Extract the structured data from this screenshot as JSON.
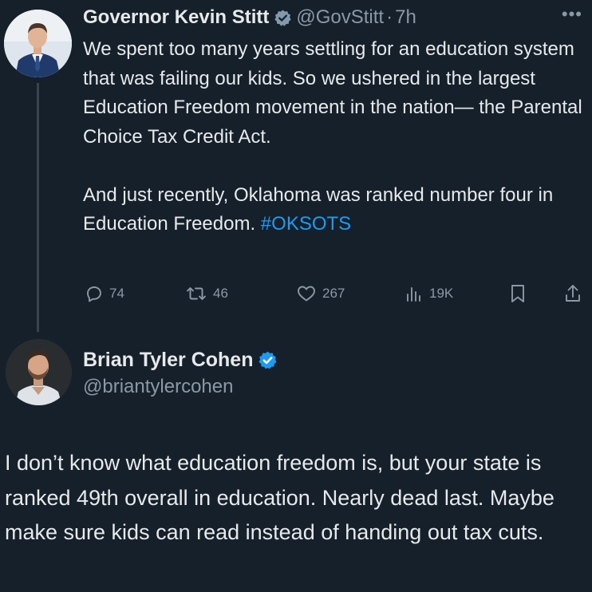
{
  "tweet1": {
    "author_name": "Governor Kevin Stitt",
    "handle": "@GovStitt",
    "separator": "·",
    "time": "7h",
    "more_label": "•••",
    "text_paragraph_1": "We spent too many years settling for an education system that was failing our kids. So we ushered in the largest Education Freedom movement in the nation— the Parental Choice Tax Credit Act.",
    "text_paragraph_2": "And just recently, Oklahoma was ranked number four in Education Freedom.",
    "hashtag": "#OKSOTS",
    "actions": {
      "replies": "74",
      "reposts": "46",
      "likes": "267",
      "views": "19K"
    },
    "badge_color": "#829aab"
  },
  "tweet2": {
    "author_name": "Brian Tyler Cohen",
    "handle": "@briantylercohen",
    "text": "I don’t know what education freedom is, but your state is ranked 49th overall in education. Nearly dead last. Maybe make sure kids can read instead of handing out tax cuts.",
    "badge_color": "#1d9bf0"
  },
  "theme": {
    "background": "#15202b",
    "text": "#e7e9ea",
    "muted": "#8b98a5",
    "accent": "#1d9bf0"
  },
  "icons": {
    "reply": "reply-icon",
    "repost": "repost-icon",
    "like": "like-icon",
    "views": "views-icon",
    "bookmark": "bookmark-icon",
    "share": "share-icon",
    "verified": "verified-badge-icon",
    "government_badge": "government-badge-icon"
  }
}
